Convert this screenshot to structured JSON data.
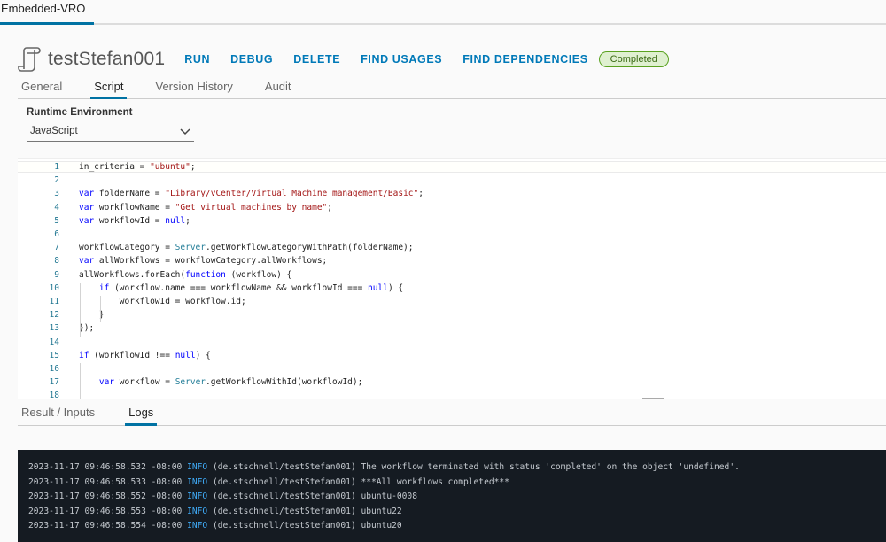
{
  "top_tab": {
    "label": "Embedded-VRO"
  },
  "header": {
    "title": "testStefan001",
    "icon": "workflow-scroll-icon",
    "actions": [
      "RUN",
      "DEBUG",
      "DELETE",
      "FIND USAGES",
      "FIND DEPENDENCIES"
    ],
    "status": "Completed",
    "accent_color": "#0079b8",
    "status_color": "#5aa220"
  },
  "subtabs": [
    {
      "label": "General",
      "active": false
    },
    {
      "label": "Script",
      "active": true
    },
    {
      "label": "Version History",
      "active": false
    },
    {
      "label": "Audit",
      "active": false
    }
  ],
  "runtime": {
    "label": "Runtime Environment",
    "selected": "JavaScript"
  },
  "code_lines": [
    {
      "n": "1",
      "text": "in_criteria = \"ubuntu\";"
    },
    {
      "n": "2",
      "text": ""
    },
    {
      "n": "3",
      "text": "var folderName = \"Library/vCenter/Virtual Machine management/Basic\";"
    },
    {
      "n": "4",
      "text": "var workflowName = \"Get virtual machines by name\";"
    },
    {
      "n": "5",
      "text": "var workflowId = null;"
    },
    {
      "n": "6",
      "text": ""
    },
    {
      "n": "7",
      "text": "workflowCategory = Server.getWorkflowCategoryWithPath(folderName);"
    },
    {
      "n": "8",
      "text": "var allWorkflows = workflowCategory.allWorkflows;"
    },
    {
      "n": "9",
      "text": "allWorkflows.forEach(function (workflow) {"
    },
    {
      "n": "10",
      "text": "    if (workflow.name === workflowName && workflowId === null) {"
    },
    {
      "n": "11",
      "text": "        workflowId = workflow.id;"
    },
    {
      "n": "12",
      "text": "    }"
    },
    {
      "n": "13",
      "text": "});"
    },
    {
      "n": "14",
      "text": ""
    },
    {
      "n": "15",
      "text": "if (workflowId !== null) {"
    },
    {
      "n": "16",
      "text": ""
    },
    {
      "n": "17",
      "text": "    var workflow = Server.getWorkflowWithId(workflowId);"
    },
    {
      "n": "18",
      "text": ""
    }
  ],
  "bottom_tabs": [
    {
      "label": "Result / Inputs",
      "active": false
    },
    {
      "label": "Logs",
      "active": true
    }
  ],
  "logs": [
    {
      "ts": "2023-11-17 09:46:58.532 -08:00",
      "level": "INFO",
      "source": "(de.stschnell/testStefan001)",
      "msg": "The workflow terminated with status 'completed' on the object 'undefined'."
    },
    {
      "ts": "2023-11-17 09:46:58.533 -08:00",
      "level": "INFO",
      "source": "(de.stschnell/testStefan001)",
      "msg": "***All workflows completed***"
    },
    {
      "ts": "2023-11-17 09:46:58.552 -08:00",
      "level": "INFO",
      "source": "(de.stschnell/testStefan001)",
      "msg": "ubuntu-0008"
    },
    {
      "ts": "2023-11-17 09:46:58.553 -08:00",
      "level": "INFO",
      "source": "(de.stschnell/testStefan001)",
      "msg": "ubuntu22"
    },
    {
      "ts": "2023-11-17 09:46:58.554 -08:00",
      "level": "INFO",
      "source": "(de.stschnell/testStefan001)",
      "msg": "ubuntu20"
    }
  ]
}
